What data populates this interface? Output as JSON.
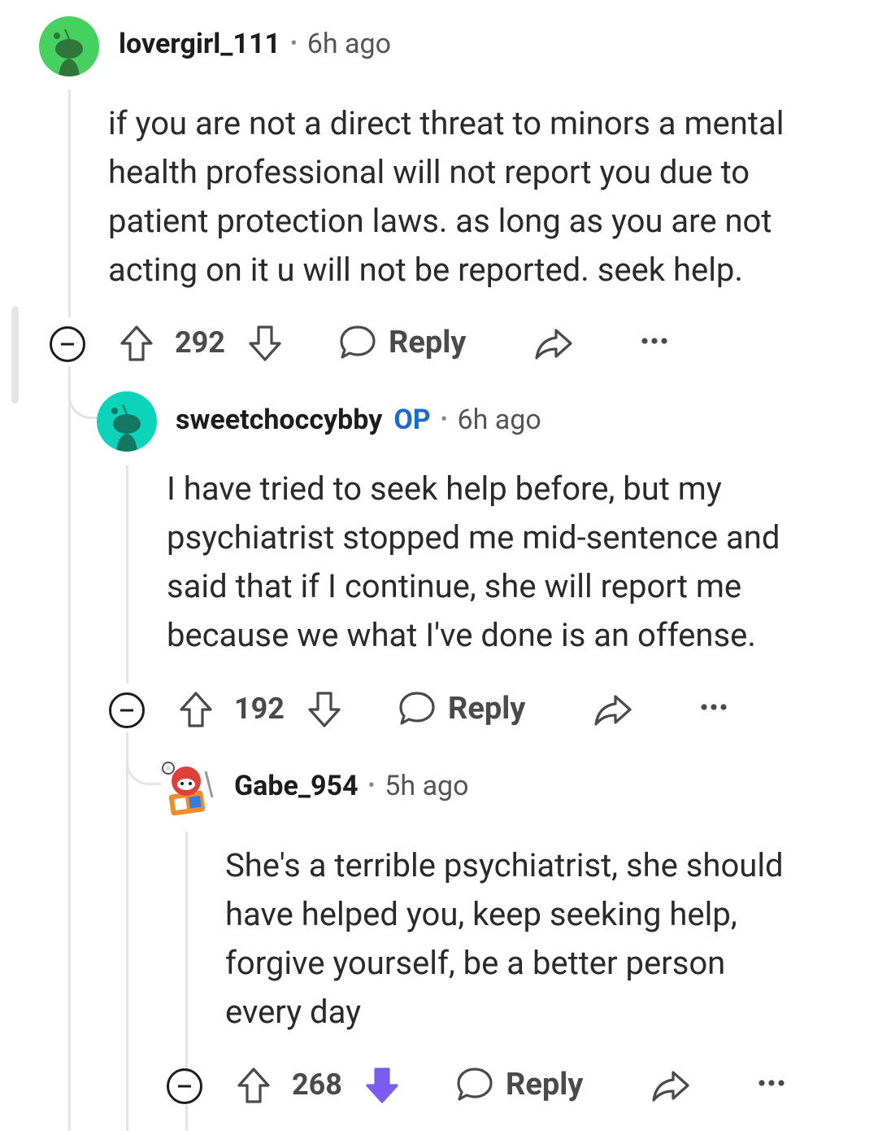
{
  "comments": [
    {
      "username": "lovergirl_111",
      "op_badge": "",
      "time": "6h ago",
      "body": "if you are not a direct threat to minors a mental\nhealth professional will not report you due to\npatient protection laws. as long as you are not\nacting on it u will not be reported. seek help.",
      "score": "292",
      "reply_label": "Reply",
      "avatar_color": "#46d160",
      "downvoted": false
    },
    {
      "username": "sweetchoccybby",
      "op_badge": "OP",
      "time": "6h ago",
      "body": "I have tried to seek help before, but my\npsychiatrist stopped me mid-sentence and\nsaid that if I continue, she will report me\nbecause we what I've done is an offense.",
      "score": "192",
      "reply_label": "Reply",
      "avatar_color": "#0dd3bb",
      "downvoted": false
    },
    {
      "username": "Gabe_954",
      "op_badge": "",
      "time": "5h ago",
      "body": "She's a terrible psychiatrist, she should\nhave helped you, keep seeking help,\nforgive yourself, be a better person\nevery day",
      "score": "268",
      "reply_label": "Reply",
      "avatar_color": "#e0403a",
      "downvoted": true,
      "downvote_color": "#7b5cf0"
    }
  ]
}
